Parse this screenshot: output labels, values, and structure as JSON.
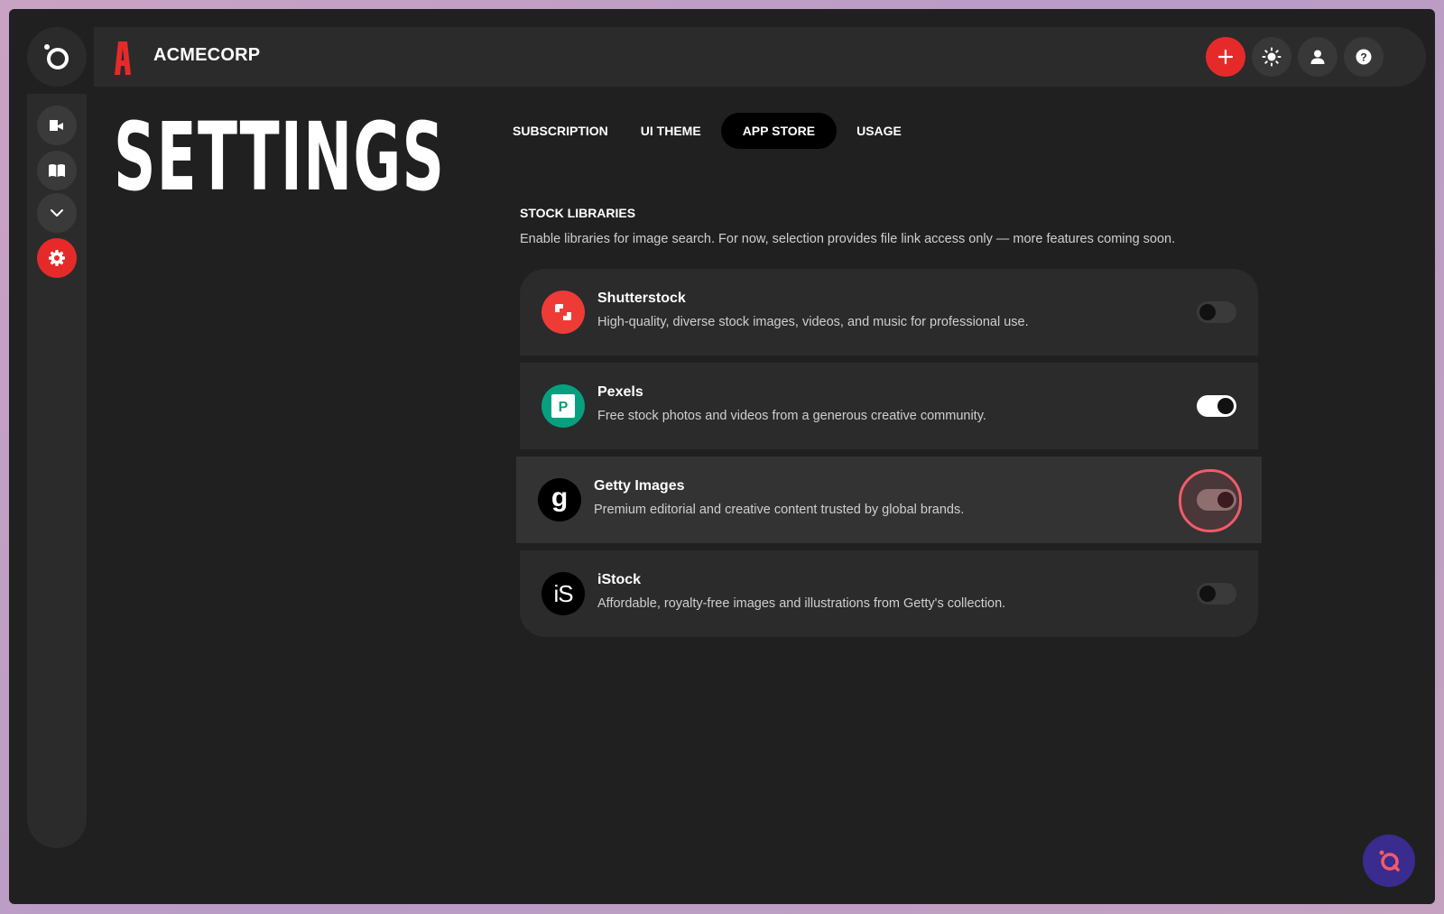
{
  "brand": {
    "name": "ACMECORP",
    "logo_letter": "A",
    "accent_color": "#e62a2a"
  },
  "header": {
    "actions": [
      {
        "icon": "plus-icon"
      },
      {
        "icon": "sun-icon"
      },
      {
        "icon": "user-icon"
      },
      {
        "icon": "help-icon",
        "glyph": "?"
      }
    ]
  },
  "sidebar": {
    "items": [
      {
        "icon": "megaphone-icon"
      },
      {
        "icon": "book-icon"
      },
      {
        "icon": "chevron-down-icon"
      },
      {
        "icon": "gear-icon",
        "active": true
      }
    ]
  },
  "page": {
    "title": "SETTINGS"
  },
  "tabs": [
    {
      "label": "SUBSCRIPTION",
      "active": false
    },
    {
      "label": "UI THEME",
      "active": false
    },
    {
      "label": "APP STORE",
      "active": true
    },
    {
      "label": "USAGE",
      "active": false
    }
  ],
  "section": {
    "title": "STOCK LIBRARIES",
    "description": "Enable libraries for image search. For now, selection provides file link access only — more features coming soon."
  },
  "libraries": [
    {
      "name": "Shutterstock",
      "description": "High-quality, diverse stock images, videos, and music for professional use.",
      "enabled": false,
      "icon": "shutterstock-logo-icon",
      "color": "#ee3b36"
    },
    {
      "name": "Pexels",
      "description": "Free stock photos and videos from a generous creative community.",
      "enabled": true,
      "icon": "pexels-logo-icon",
      "icon_letter": "P",
      "color": "#06a081"
    },
    {
      "name": "Getty Images",
      "description": "Premium editorial and creative content trusted by global brands.",
      "enabled": true,
      "focused": true,
      "icon": "getty-logo-icon",
      "icon_letter": "g",
      "color": "#000000"
    },
    {
      "name": "iStock",
      "description": "Affordable, royalty-free images and illustrations from Getty's collection.",
      "enabled": false,
      "icon": "istock-logo-icon",
      "icon_letter": "iS",
      "color": "#000000"
    }
  ],
  "assistant": {
    "icon": "assistant-chat-icon"
  }
}
